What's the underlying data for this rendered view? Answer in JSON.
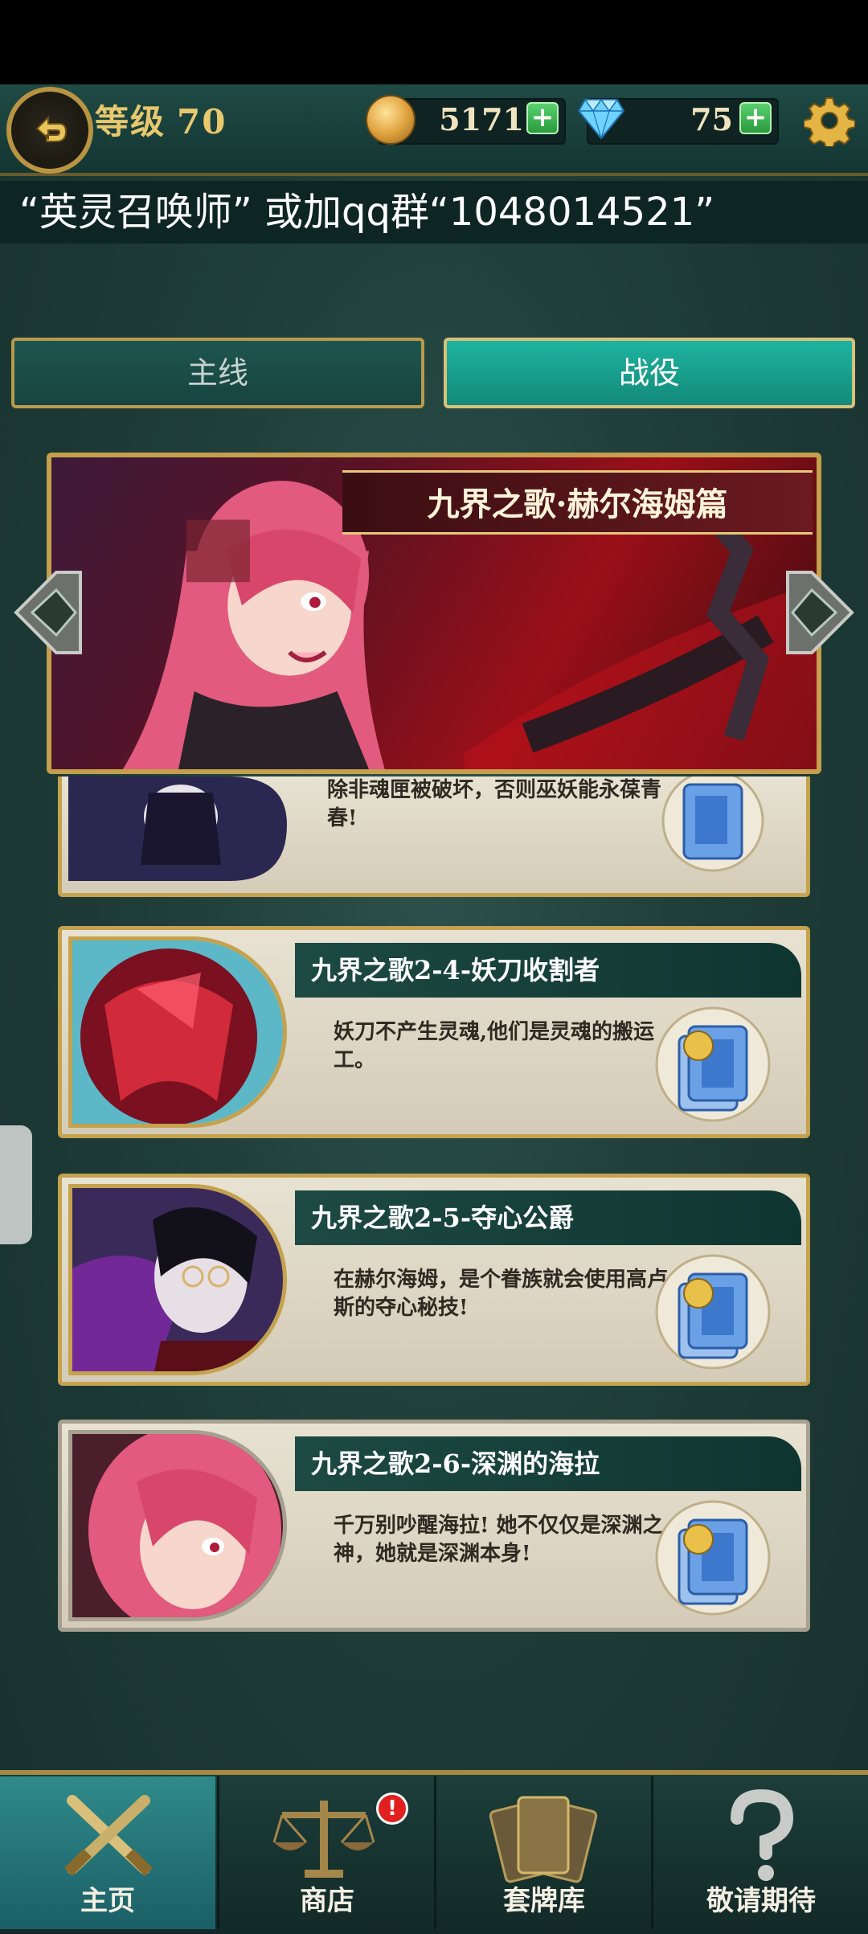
{
  "header": {
    "level_label": "等级",
    "level_value": "70",
    "coins": "5171",
    "gems": "75",
    "plus": "+"
  },
  "notice": "“英灵召唤师” 或加qq群“1048014521”",
  "tabs": [
    {
      "label": "主线",
      "active": false
    },
    {
      "label": "战役",
      "active": true
    }
  ],
  "banner": {
    "title": "九界之歌·赫尔海姆篇"
  },
  "partial_card": {
    "desc": "除非魂匣被破坏，否则巫妖能永葆青春!"
  },
  "cards": [
    {
      "title": "九界之歌2-4-妖刀收割者",
      "desc": "妖刀不产生灵魂,他们是灵魂的搬运工。",
      "accent": "#b0213a"
    },
    {
      "title": "九界之歌2-5-夺心公爵",
      "desc": "在赫尔海姆，是个眷族就会使用高卢斯的夺心秘技!",
      "accent": "#5a3a7a"
    },
    {
      "title": "九界之歌2-6-深渊的海拉",
      "desc": "千万别吵醒海拉! 她不仅仅是深渊之神，她就是深渊本身!",
      "accent": "#e07a8a"
    }
  ],
  "nav": [
    {
      "label": "主页",
      "icon": "crossed-swords-icon",
      "active": true
    },
    {
      "label": "商店",
      "icon": "scale-icon",
      "badge": "!"
    },
    {
      "label": "套牌库",
      "icon": "cards-icon"
    },
    {
      "label": "敬请期待",
      "icon": "question-icon"
    }
  ],
  "colors": {
    "accent_gold": "#c4a24e",
    "teal_active": "#1fb3a0",
    "bg": "#1c3a37"
  }
}
